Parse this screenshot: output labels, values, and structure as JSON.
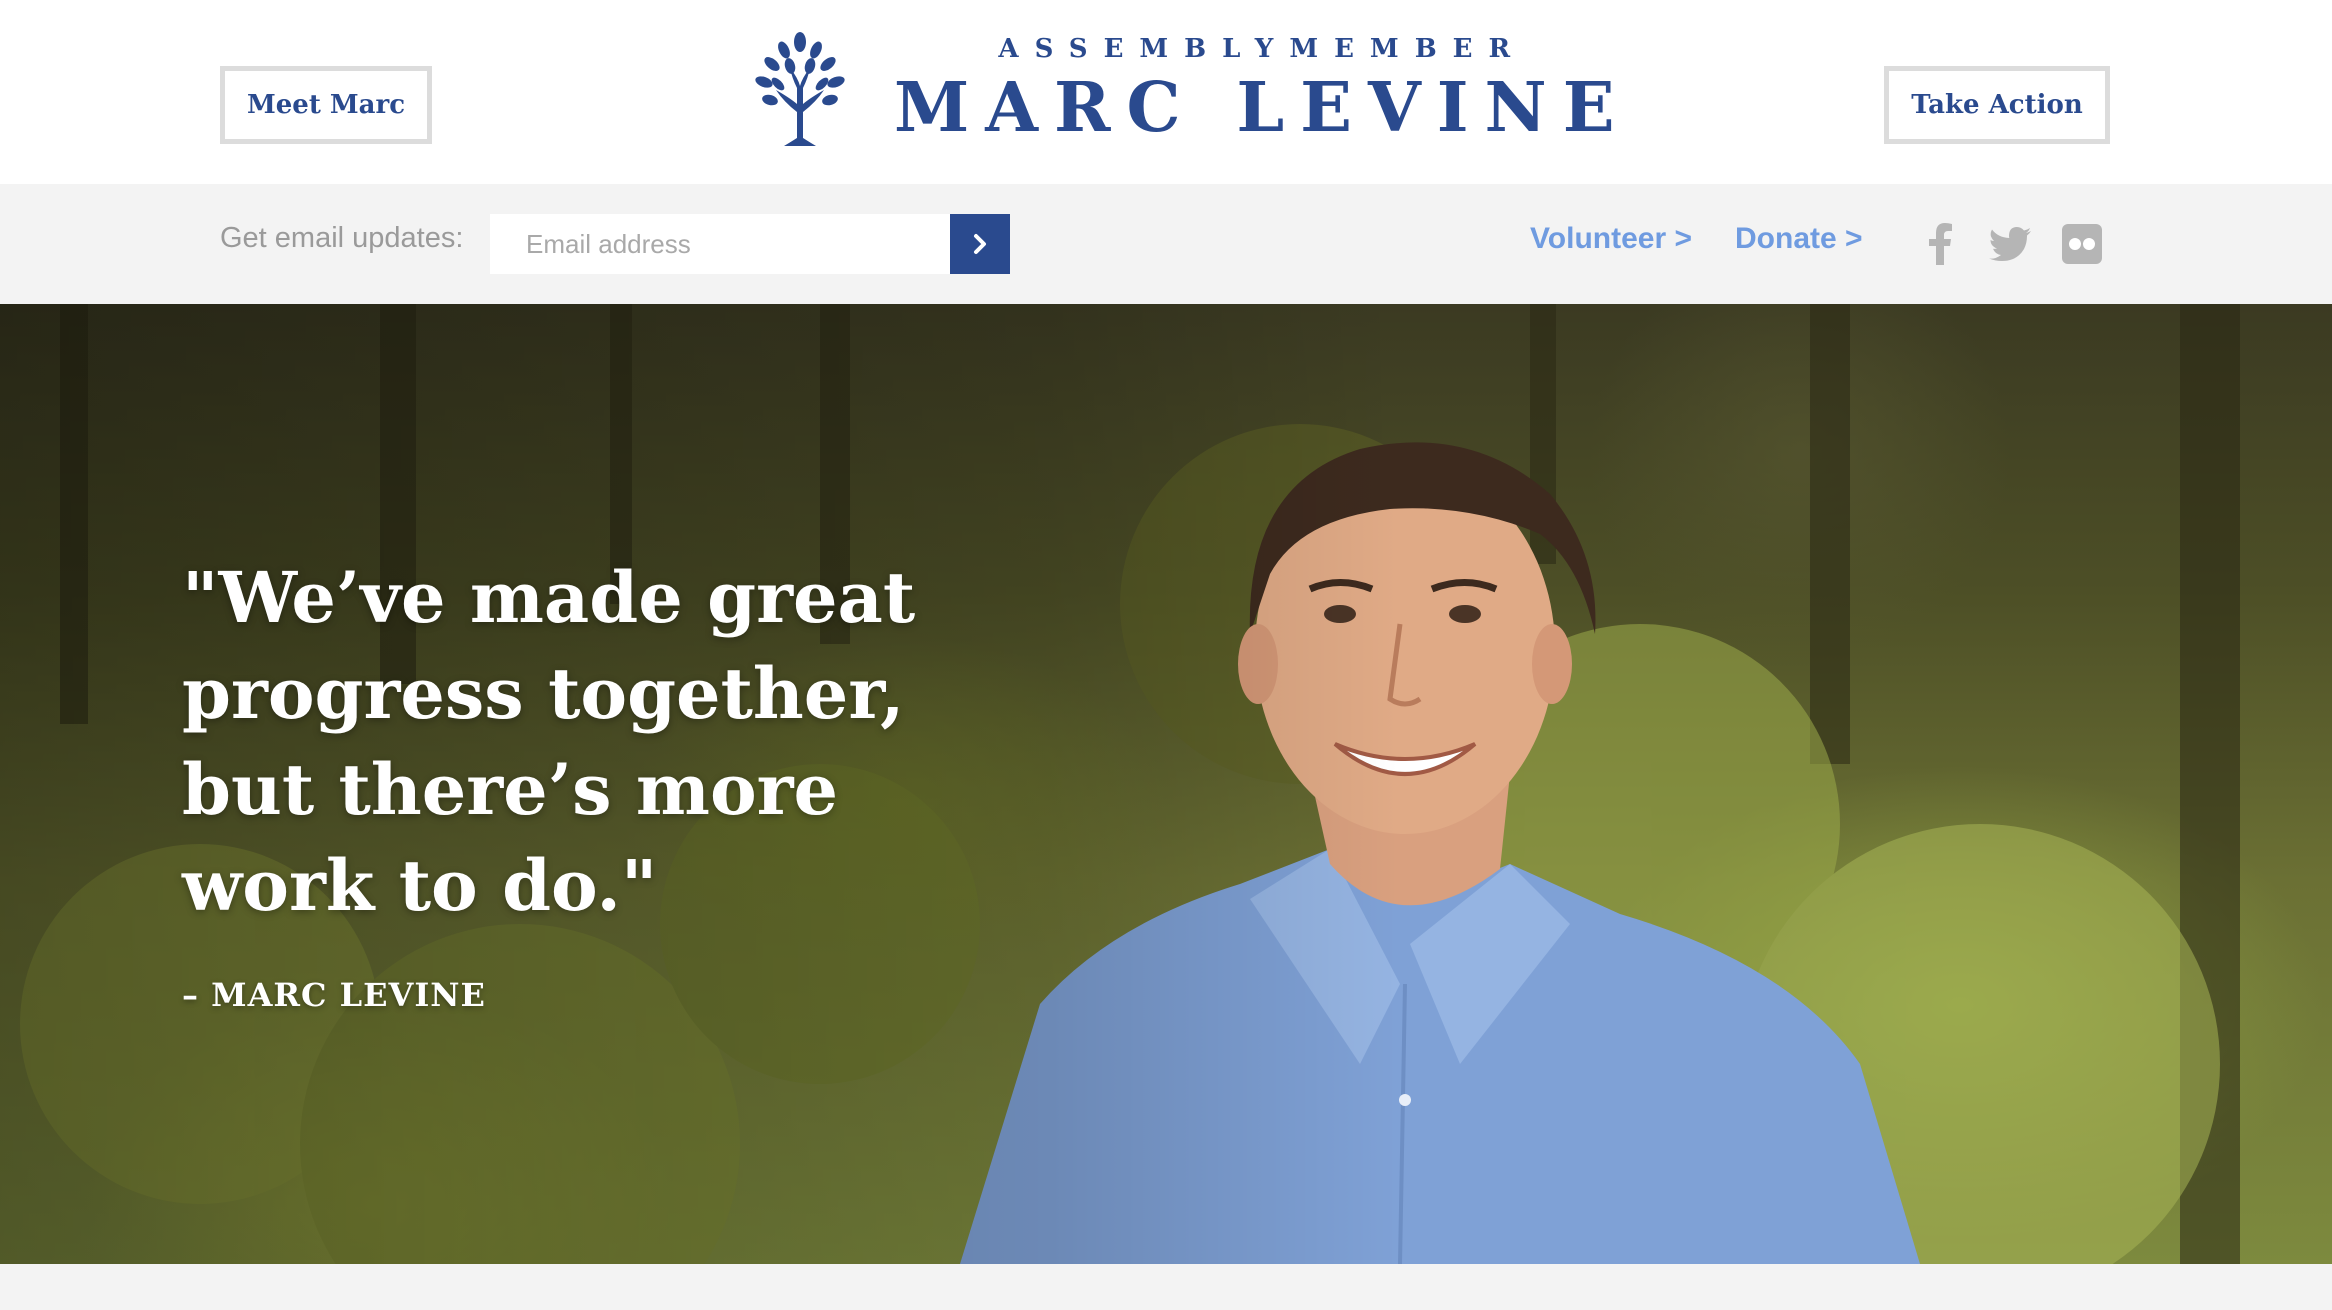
{
  "header": {
    "meet_label": "Meet Marc",
    "action_label": "Take Action",
    "logo_subtitle": "ASSEMBLYMEMBER",
    "logo_title": "MARC LEVINE"
  },
  "subbar": {
    "email_label": "Get email updates:",
    "email_placeholder": "Email address",
    "email_value": "",
    "submit_icon": "chevron-right-icon",
    "volunteer_label": "Volunteer >",
    "donate_label": "Donate >",
    "social_icons": [
      "facebook-icon",
      "twitter-icon",
      "flickr-icon"
    ]
  },
  "hero": {
    "quote": "\"We’ve made great progress together, but there’s more work to do.\"",
    "attribution": "– MARC LEVINE"
  },
  "colors": {
    "brand_navy": "#2a4a8e",
    "link_blue": "#6f9be0",
    "bar_gray": "#f3f3f3",
    "button_border": "#dcdcdc",
    "social_gray": "#b5b5b5"
  }
}
